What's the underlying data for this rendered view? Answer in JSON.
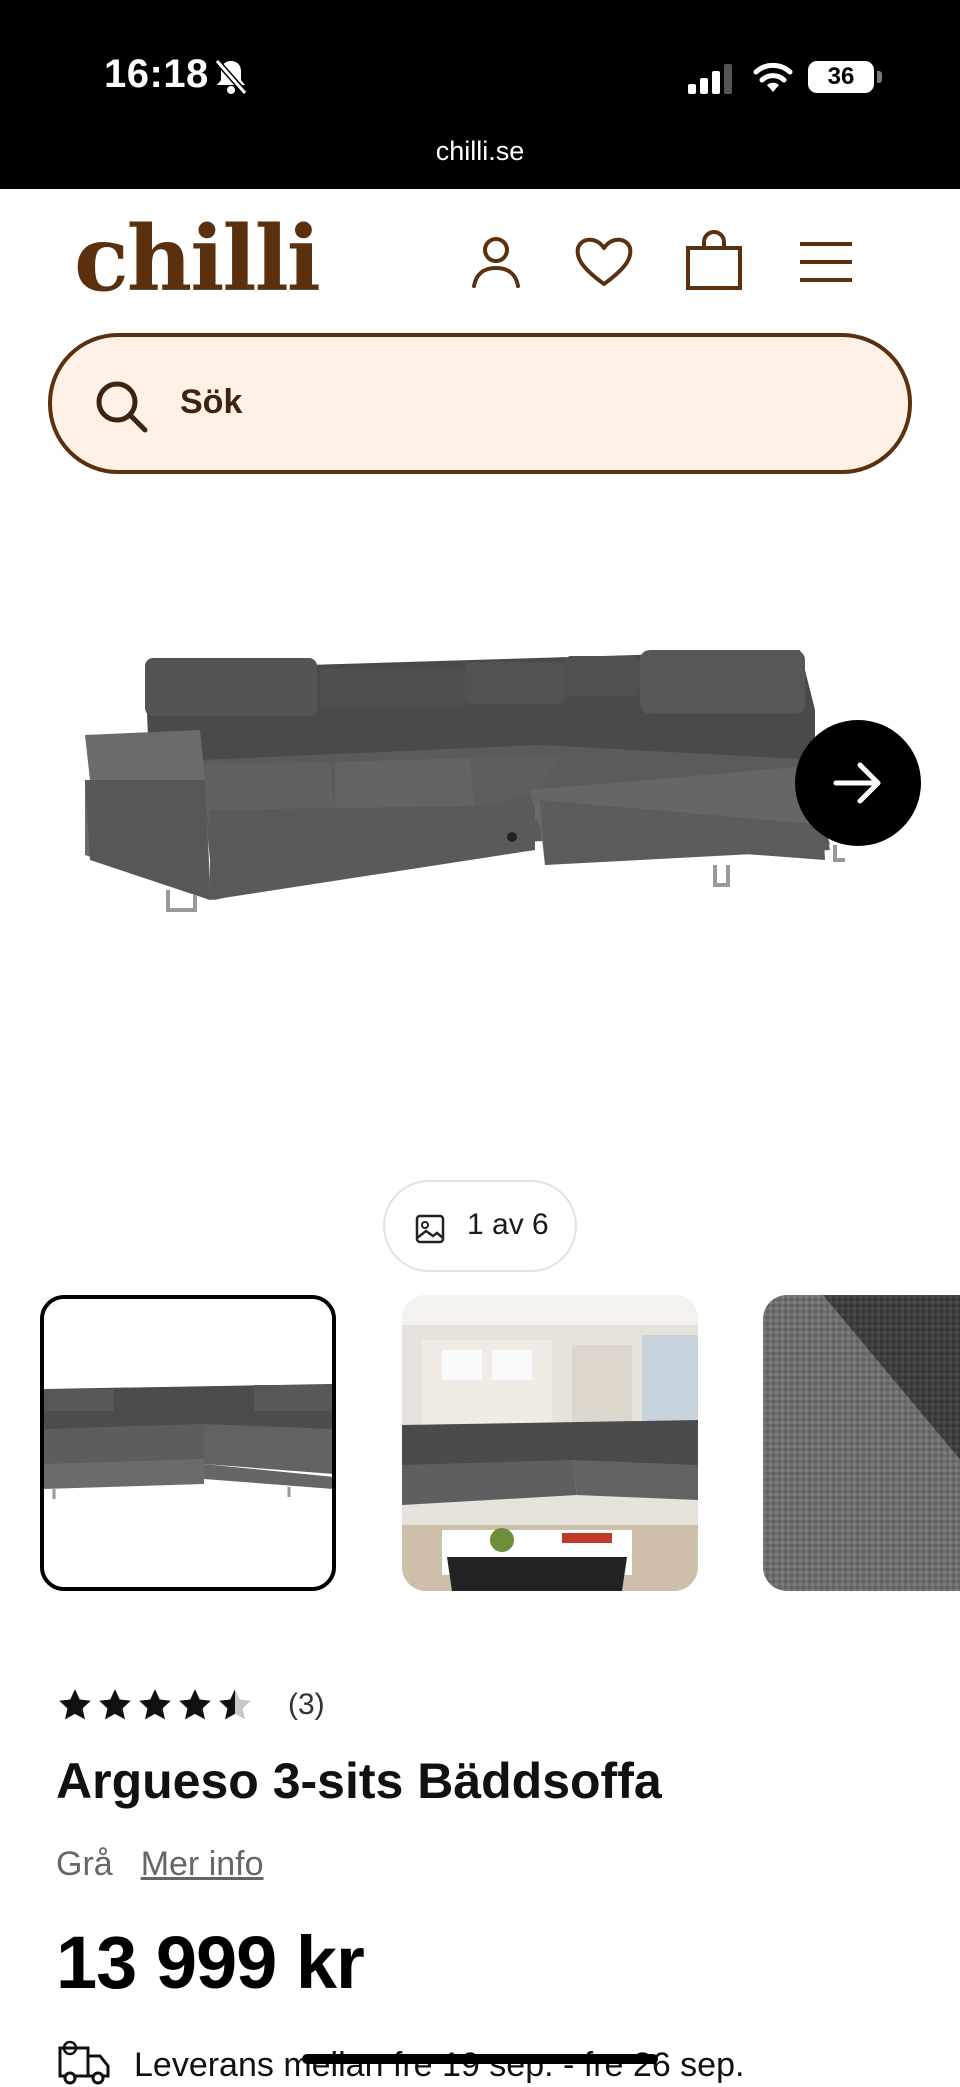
{
  "status_bar": {
    "time": "16:18",
    "battery": "36",
    "url": "chilli.se",
    "icons": [
      "bell-slash-icon",
      "signal-icon",
      "wifi-icon",
      "battery-icon"
    ]
  },
  "header": {
    "logo": "chilli",
    "brand_color": "#5a300f",
    "icons": [
      "user-icon",
      "heart-icon",
      "bag-icon",
      "menu-icon"
    ]
  },
  "search": {
    "placeholder": "Sök",
    "background": "#fff1e6"
  },
  "gallery": {
    "counter": "1 av 6",
    "next_icon": "arrow-right-icon",
    "thumbnails": [
      "sofa-white-background",
      "sofa-living-room",
      "fabric-closeup"
    ]
  },
  "product": {
    "rating": 4.5,
    "rating_max": 5,
    "review_count": "(3)",
    "title": "Argueso 3-sits Bäddsoffa",
    "color": "Grå",
    "more_info": "Mer info",
    "price": "13 999 kr",
    "delivery": "Leverans mellan fre 19 sep. - fre 26 sep."
  }
}
